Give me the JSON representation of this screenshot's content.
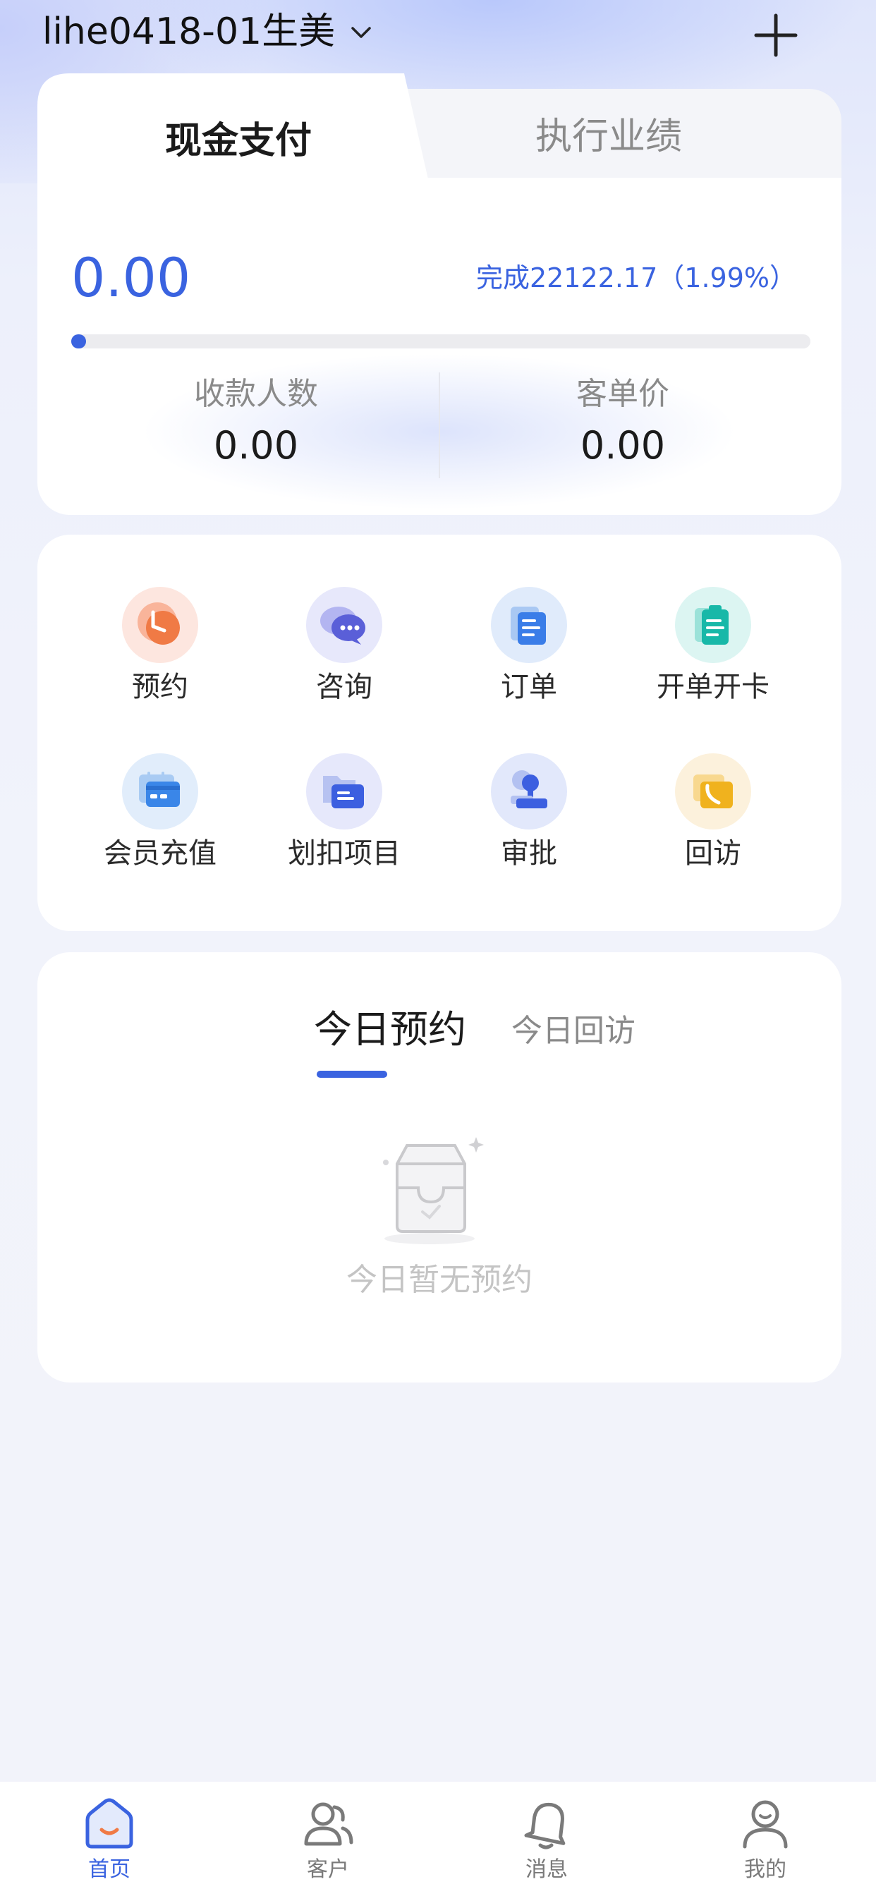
{
  "header": {
    "store_name": "lihe0418-01生美"
  },
  "performance": {
    "tabs": [
      "现金支付",
      "执行业绩"
    ],
    "active_tab": "现金支付",
    "amount": "0.00",
    "completion_text": "完成22122.17（1.99%）",
    "progress_percent": 1.99,
    "stats": [
      {
        "label": "收款人数",
        "value": "0.00"
      },
      {
        "label": "客单价",
        "value": "0.00"
      }
    ]
  },
  "actions": [
    {
      "label": "预约",
      "icon": "clock-icon",
      "color": "#f07a45"
    },
    {
      "label": "咨询",
      "icon": "chat-bubbles-icon",
      "color": "#5a5fd8"
    },
    {
      "label": "订单",
      "icon": "document-icon",
      "color": "#3a7de8"
    },
    {
      "label": "开单开卡",
      "icon": "clipboard-icon",
      "color": "#18b8a8"
    },
    {
      "label": "会员充值",
      "icon": "calendar-card-icon",
      "color": "#3a86e8"
    },
    {
      "label": "划扣项目",
      "icon": "folder-icon",
      "color": "#3c5fe0"
    },
    {
      "label": "审批",
      "icon": "stamp-icon",
      "color": "#3c5fe0"
    },
    {
      "label": "回访",
      "icon": "phone-card-icon",
      "color": "#f0b21e"
    }
  ],
  "today": {
    "tabs": [
      "今日预约",
      "今日回访"
    ],
    "active_tab": "今日预约",
    "empty_text": "今日暂无预约"
  },
  "bottom_nav": [
    {
      "label": "首页",
      "icon": "home-icon",
      "active": true
    },
    {
      "label": "客户",
      "icon": "customers-icon",
      "active": false
    },
    {
      "label": "消息",
      "icon": "bell-icon",
      "active": false
    },
    {
      "label": "我的",
      "icon": "profile-icon",
      "active": false
    }
  ],
  "colors": {
    "accent": "#3a63e0",
    "text_primary": "#1b1b1b",
    "text_secondary": "#8a8a8a"
  }
}
